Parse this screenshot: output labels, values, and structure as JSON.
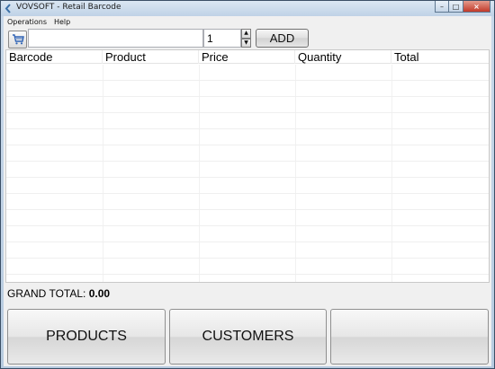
{
  "window": {
    "title": "VOVSOFT - Retail Barcode",
    "buttons": {
      "minimize": "–",
      "maximize": "□",
      "close": "×"
    }
  },
  "menu": {
    "items": [
      "Operations",
      "Help"
    ]
  },
  "toolbar": {
    "cart_icon": "shopping-cart-icon",
    "barcode_value": "",
    "quantity_value": "1",
    "spin_up": "▲",
    "spin_down": "▼",
    "add_label": "ADD"
  },
  "grid": {
    "columns": [
      "Barcode",
      "Product",
      "Price",
      "Quantity",
      "Total"
    ],
    "rows": []
  },
  "summary": {
    "grand_total_label": "GRAND TOTAL:",
    "grand_total_value": "0.00"
  },
  "actions": {
    "products_label": "PRODUCTS",
    "customers_label": "CUSTOMERS",
    "third_label": ""
  }
}
